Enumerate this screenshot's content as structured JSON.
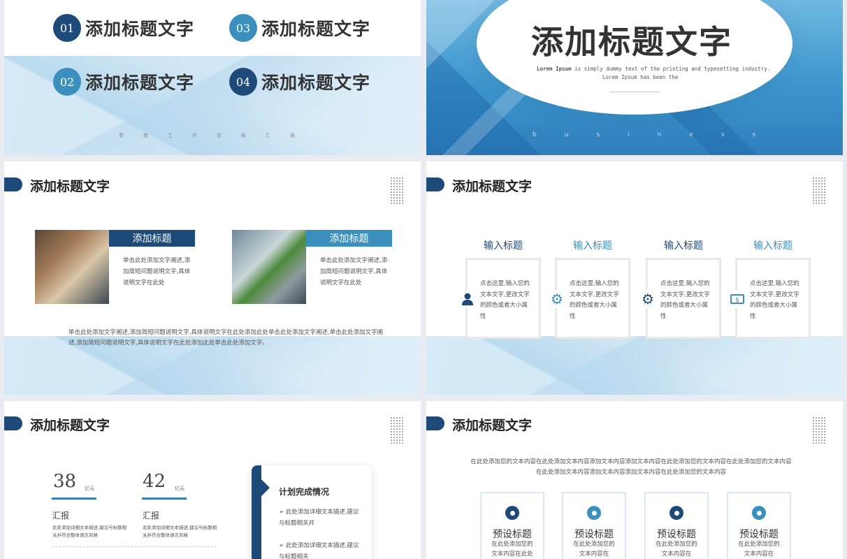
{
  "slide1": {
    "items": [
      {
        "num": "01",
        "title": "添加标题文字"
      },
      {
        "num": "03",
        "title": "添加标题文字"
      },
      {
        "num": "02",
        "title": "添加标题文字"
      },
      {
        "num": "04",
        "title": "添加标题文字"
      }
    ],
    "footer": "季度工作总结汇报"
  },
  "slide2": {
    "title": "添加标题文字",
    "line1_bold": "Lorem Ipsum",
    "line1_rest": " is simply dummy text of the printing and typesetting industry.",
    "line2": "Lorem Ipsum has been the",
    "footer": "business"
  },
  "slide3": {
    "header": "添加标题文字",
    "cards": [
      {
        "label": "添加标题",
        "text": "单击此处添加文字阐述,添加简短问题说明文字,具体说明文字在此处"
      },
      {
        "label": "添加标题",
        "text": "单击此处添加文字阐述,添加简短问题说明文字,具体说明文字在此处"
      }
    ],
    "paragraph": "单击此处添加文字阐述,添加简短问题说明文字,具体说明文字在此处添加此处单击此处添加文字阐述,单击此处添加文字阐述,添加简短问题说明文字,具体说明文字在此处添加此处单击此处添加文字。"
  },
  "slide4": {
    "header": "添加标题文字",
    "items": [
      {
        "title": "输入标题",
        "text": "点击这里,输入您的文本文字,更改文字的颜色或者大小属性",
        "icon": "user-icon"
      },
      {
        "title": "输入标题",
        "text": "点击这里,输入您的文本文字,更改文字的颜色或者大小属性",
        "icon": "gear-icon"
      },
      {
        "title": "输入标题",
        "text": "点击这里,输入您的文本文字,更改文字的颜色或者大小属性",
        "icon": "settings-icon"
      },
      {
        "title": "输入标题",
        "text": "点击这里,输入您的文本文字,更改文字的颜色或者大小属性",
        "icon": "money-icon"
      }
    ],
    "colors": {
      "dark": "#1d4a78",
      "light": "#3b8fbd"
    }
  },
  "slide5": {
    "header": "添加标题文字",
    "stats": [
      {
        "value": "38",
        "unit": "亿元",
        "label": "汇报",
        "desc": "此处添加详细文本描述,建议与标题相关并符合整体语言风格"
      },
      {
        "value": "42",
        "unit": "亿元",
        "label": "汇报",
        "desc": "此处添加详细文本描述,建议与标题相关并符合整体语言风格"
      }
    ],
    "plan": {
      "title": "计划完成情况",
      "items": [
        "此处添加详细文本描述,建议与标题相关并",
        "此处添加详细文本描述,建议与标题相关"
      ]
    }
  },
  "slide6": {
    "header": "添加标题文字",
    "intro": "在此处添加您的文本内容在此处添加文本内容添加文本内容添加文本内容在此处添加您的文本内容在此处添加您的文本内容在此处添加文本内容添加文本内容添加文本内容在此处添加您的文本内容",
    "cards": [
      {
        "title": "预设标题",
        "text": "在此处添加您的文本内容在此处"
      },
      {
        "title": "预设标题",
        "text": "在此处添加您的文本内容在"
      },
      {
        "title": "预设标题",
        "text": "在此处添加您的文本内容在"
      },
      {
        "title": "预设标题",
        "text": "在此处添加您的文本内容在"
      }
    ]
  }
}
